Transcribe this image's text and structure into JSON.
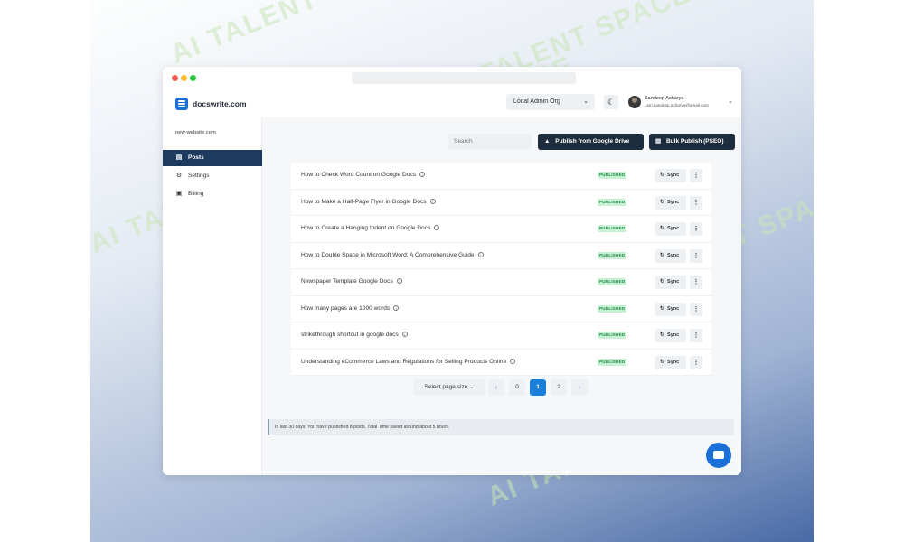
{
  "watermark": "AI TALENT SPACE",
  "app": {
    "logo_text": "docswrite.com",
    "org_select": "Local Admin Org",
    "user": {
      "name": "Sandeep Acharya",
      "email": "i.am.sandeep.acharya@gmail.com"
    }
  },
  "sidebar": {
    "site_name": "new-website.com",
    "items": [
      {
        "label": "Posts",
        "icon": "document-icon",
        "active": true
      },
      {
        "label": "Settings",
        "icon": "gear-icon",
        "active": false
      },
      {
        "label": "Billing",
        "icon": "billing-icon",
        "active": false
      }
    ]
  },
  "toolbar": {
    "search_placeholder": "Search",
    "publish_drive_label": "Publish from Google Drive",
    "bulk_publish_label": "Bulk Publish (PSEO)"
  },
  "posts": [
    {
      "title": "How to Check Word Count on Google Docs",
      "status": "PUBLISHED",
      "action": "Sync"
    },
    {
      "title": "How to Make a Half-Page Flyer in Google Docs",
      "status": "PUBLISHED",
      "action": "Sync"
    },
    {
      "title": "How to Create a Hanging Indent on Google Docs",
      "status": "PUBLISHED",
      "action": "Sync"
    },
    {
      "title": "How to Double Space in Microsoft Word: A Comprehensive Guide",
      "status": "PUBLISHED",
      "action": "Sync"
    },
    {
      "title": "Newspaper Template Google Docs",
      "status": "PUBLISHED",
      "action": "Sync"
    },
    {
      "title": "How many pages are 1000 words",
      "status": "PUBLISHED",
      "action": "Sync"
    },
    {
      "title": "strikethrough shortcut in google docs",
      "status": "PUBLISHED",
      "action": "Sync"
    },
    {
      "title": "Understanding eCommerce Laws and Regulations for Selling Products Online",
      "status": "PUBLISHED",
      "action": "Sync"
    }
  ],
  "pagination": {
    "page_size_label": "Select page size",
    "pages": [
      "0",
      "1",
      "2"
    ],
    "current": "1"
  },
  "info_message": "In last 30 days, You have published 8 posts. Total Time saved around about 5 hours.",
  "colors": {
    "accent": "#1a7fd9",
    "sidebar_active": "#1e3a5f",
    "published_badge": "#c8f1d3"
  }
}
